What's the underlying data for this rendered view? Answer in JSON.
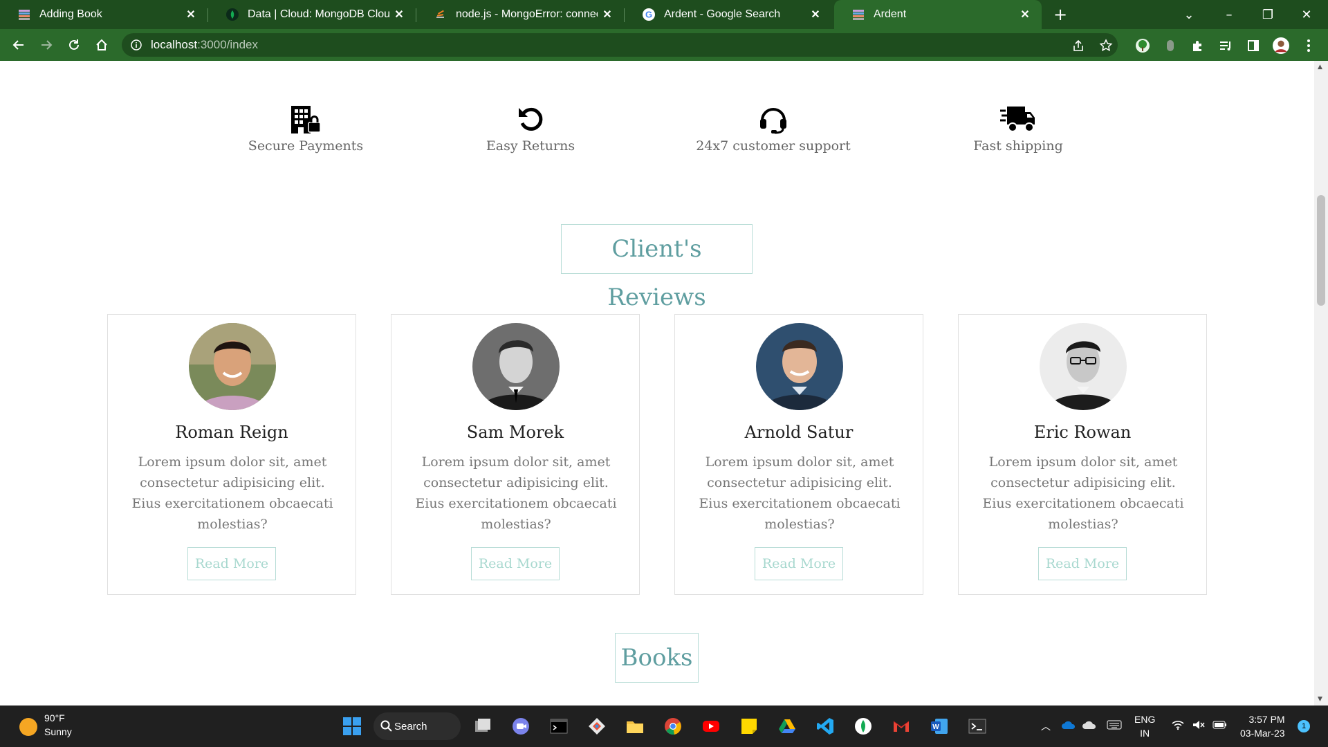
{
  "browser": {
    "tabs": [
      {
        "label": "Adding Book",
        "icon": "books-favicon"
      },
      {
        "label": "Data | Cloud: MongoDB Cloud",
        "icon": "mongodb-leaf-favicon"
      },
      {
        "label": "node.js - MongoError: connect EC",
        "icon": "stackoverflow-favicon"
      },
      {
        "label": "Ardent - Google Search",
        "icon": "google-favicon"
      },
      {
        "label": "Ardent",
        "icon": "books-favicon",
        "active": true
      }
    ],
    "url_host": "localhost",
    "url_path": ":3000/index"
  },
  "features": [
    {
      "label": "Secure Payments",
      "icon": "building-lock-icon"
    },
    {
      "label": "Easy Returns",
      "icon": "rotate-left-icon"
    },
    {
      "label": "24x7 customer support",
      "icon": "headset-icon"
    },
    {
      "label": "Fast shipping",
      "icon": "truck-fast-icon"
    }
  ],
  "reviews": {
    "title": "Client's Reviews",
    "clients": [
      {
        "name": "Roman Reign",
        "text": "Lorem ipsum dolor sit, amet consectetur adipisicing elit. Eius exercitationem obcaecati molestias?",
        "button": "Read More"
      },
      {
        "name": "Sam Morek",
        "text": "Lorem ipsum dolor sit, amet consectetur adipisicing elit. Eius exercitationem obcaecati molestias?",
        "button": "Read More"
      },
      {
        "name": "Arnold Satur",
        "text": "Lorem ipsum dolor sit, amet consectetur adipisicing elit. Eius exercitationem obcaecati molestias?",
        "button": "Read More"
      },
      {
        "name": "Eric Rowan",
        "text": "Lorem ipsum dolor sit, amet consectetur adipisicing elit. Eius exercitationem obcaecati molestias?",
        "button": "Read More"
      }
    ]
  },
  "books": {
    "title": "Books"
  },
  "taskbar": {
    "temperature": "90°F",
    "condition": "Sunny",
    "search_label": "Search",
    "lang_line1": "ENG",
    "lang_line2": "IN",
    "time": "3:57 PM",
    "date": "03-Mar-23",
    "notification_count": "1"
  },
  "colors": {
    "chrome": "#2b6a2b",
    "accent_teal": "#5f9ea0",
    "button_text": "#a8d8cf"
  }
}
